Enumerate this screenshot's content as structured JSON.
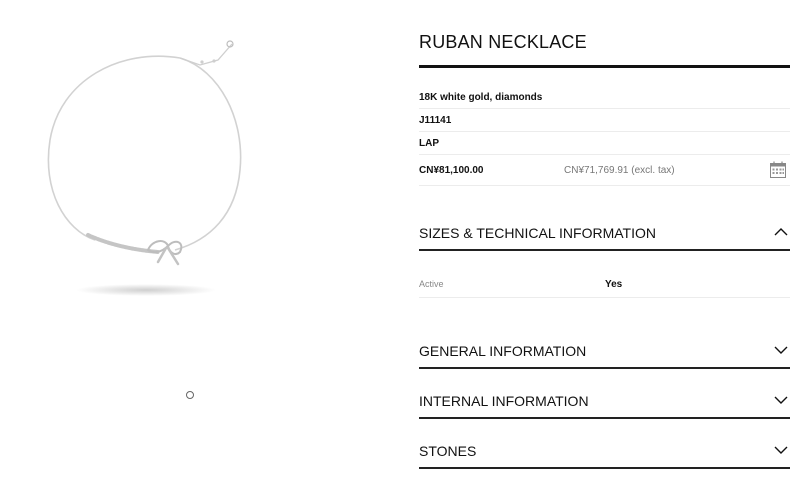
{
  "product": {
    "title": "RUBAN NECKLACE",
    "material": "18K white gold, diamonds",
    "reference": "J11141",
    "category": "LAP",
    "price": "CN¥81,100.00",
    "price_excl_tax": "CN¥71,769.91 (excl. tax)"
  },
  "image": {
    "icon": "necklace-image",
    "carousel_dots": 1
  },
  "sections": {
    "sizes": {
      "label": "SIZES & TECHNICAL INFORMATION",
      "expanded": true,
      "icon": "chevron-up-icon"
    },
    "general": {
      "label": "GENERAL INFORMATION",
      "expanded": false,
      "icon": "chevron-down-icon"
    },
    "internal": {
      "label": "INTERNAL INFORMATION",
      "expanded": false,
      "icon": "chevron-down-icon"
    },
    "stones": {
      "label": "STONES",
      "expanded": false,
      "icon": "chevron-down-icon"
    }
  },
  "details": [
    {
      "key": "Active",
      "value": "Yes"
    }
  ],
  "icons": {
    "calendar": "calendar-icon"
  }
}
